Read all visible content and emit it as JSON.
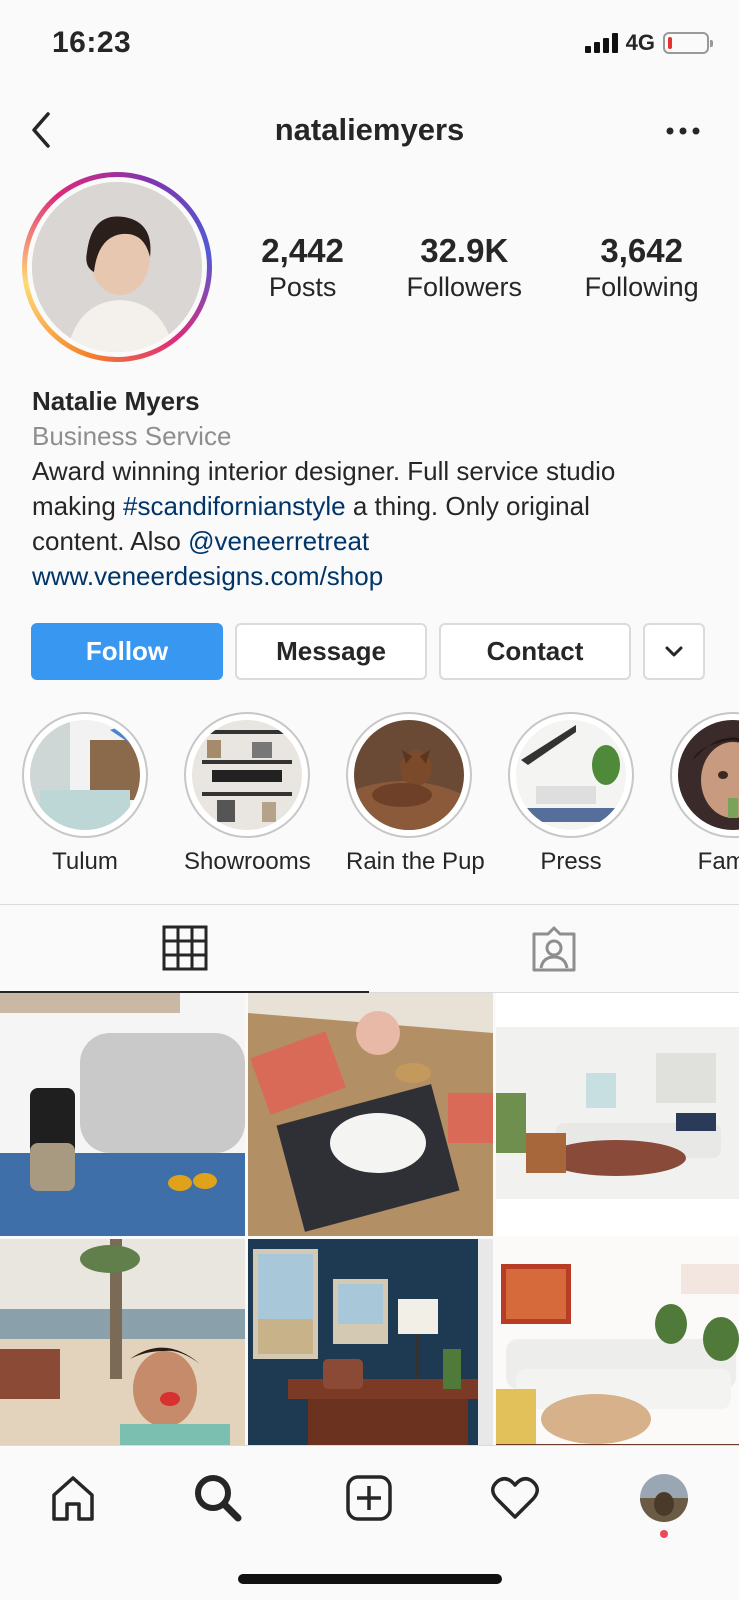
{
  "status": {
    "time": "16:23",
    "network": "4G",
    "battery_color": "#e5342f",
    "battery_level": 0.1
  },
  "header": {
    "username": "nataliemyers",
    "back_icon": "chevron-left-icon",
    "more_icon": "ellipsis-icon"
  },
  "stats": [
    {
      "value": "2,442",
      "label": "Posts"
    },
    {
      "value": "32.9K",
      "label": "Followers"
    },
    {
      "value": "3,642",
      "label": "Following"
    }
  ],
  "bio": {
    "name": "Natalie Myers",
    "category": "Business Service",
    "line1": "Award winning interior designer. Full service studio",
    "line2_pre": "making ",
    "hashtag": "#scandifornianstyle",
    "line2_post": " a thing. Only original",
    "line3_pre": "content. Also ",
    "mention": "@veneerretreat",
    "website": "www.veneerdesigns.com/shop"
  },
  "actions": {
    "follow": "Follow",
    "message": "Message",
    "contact": "Contact",
    "more_icon": "chevron-down-icon"
  },
  "highlights": [
    {
      "label": "Tulum"
    },
    {
      "label": "Showrooms"
    },
    {
      "label": "Rain the Pup"
    },
    {
      "label": "Press"
    },
    {
      "label": "Family"
    }
  ],
  "tabs": {
    "grid_icon": "grid-icon",
    "tagged_icon": "tagged-person-icon"
  },
  "bottom_nav": [
    "home-icon",
    "search-icon",
    "new-post-icon",
    "heart-icon",
    "profile-avatar"
  ],
  "colors": {
    "accent": "#3897f0",
    "link": "#003569",
    "muted": "#8e8e8e",
    "notification": "#ed4956"
  }
}
